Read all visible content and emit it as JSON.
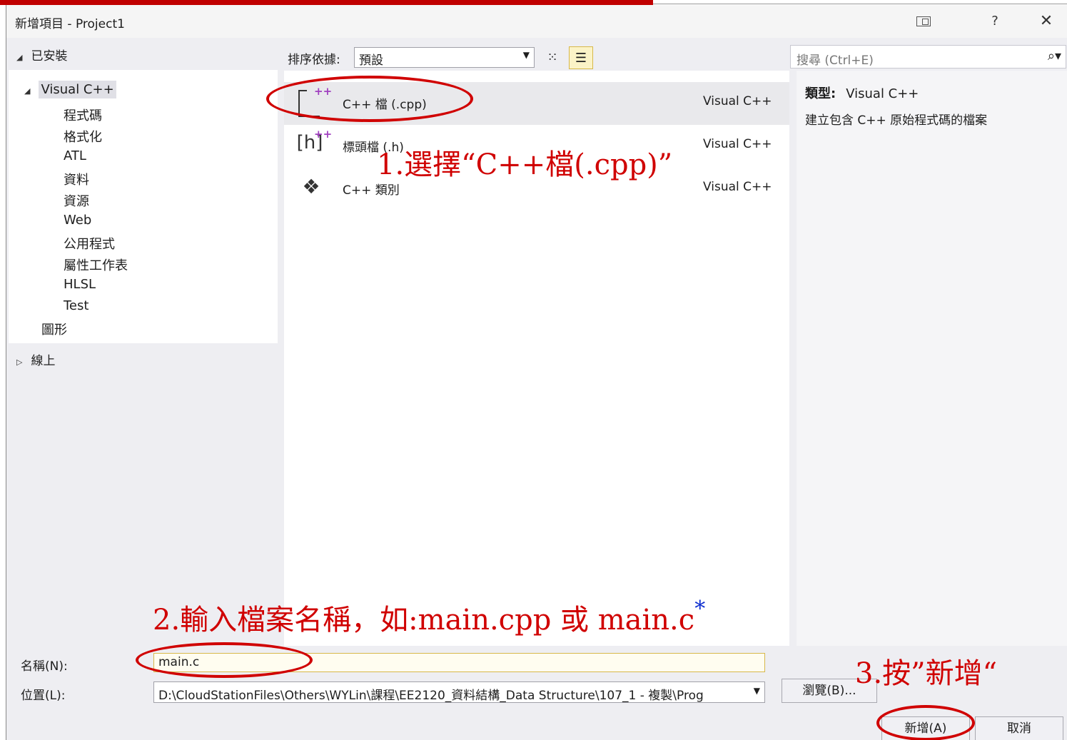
{
  "window": {
    "title": "新增項目 - Project1",
    "help_label": "?",
    "close_label": "✕"
  },
  "left_panel": {
    "installed_label": "已安裝",
    "root_item": "Visual C++",
    "children": [
      "程式碼",
      "格式化",
      "ATL",
      "資料",
      "資源",
      "Web",
      "公用程式",
      "屬性工作表",
      "HLSL",
      "Test"
    ],
    "graphics_item": "圖形",
    "online_label": "線上"
  },
  "toolbar": {
    "sort_label": "排序依據:",
    "sort_value": "預設",
    "search_placeholder": "搜尋 (Ctrl+E)"
  },
  "templates": [
    {
      "name": "C++ 檔 (.cpp)",
      "type": "Visual C++",
      "icon": "cpp-file-icon"
    },
    {
      "name": "標頭檔 (.h)",
      "type": "Visual C++",
      "icon": "header-file-icon"
    },
    {
      "name": "C++ 類別",
      "type": "Visual C++",
      "icon": "class-icon"
    }
  ],
  "details": {
    "type_label": "類型:",
    "type_value": "Visual C++",
    "description": "建立包含 C++ 原始程式碼的檔案"
  },
  "form": {
    "name_label": "名稱(N):",
    "name_value": "main.c",
    "location_label": "位置(L):",
    "location_value": "D:\\CloudStationFiles\\Others\\WYLin\\課程\\EE2120_資料結構_Data Structure\\107_1 - 複製\\Prog",
    "browse_label": "瀏覽(B)...",
    "add_label": "新增(A)",
    "cancel_label": "取消"
  },
  "annotations": {
    "step1": "1.選擇“C++檔(.cpp)”",
    "step2": "2.輸入檔案名稱，如:main.cpp 或 main.c",
    "step2_star": "*",
    "step3": "3.按”新增“"
  },
  "colors": {
    "annotation": "#d00000",
    "star": "#1030d0",
    "accent_border": "#d7b84a"
  }
}
